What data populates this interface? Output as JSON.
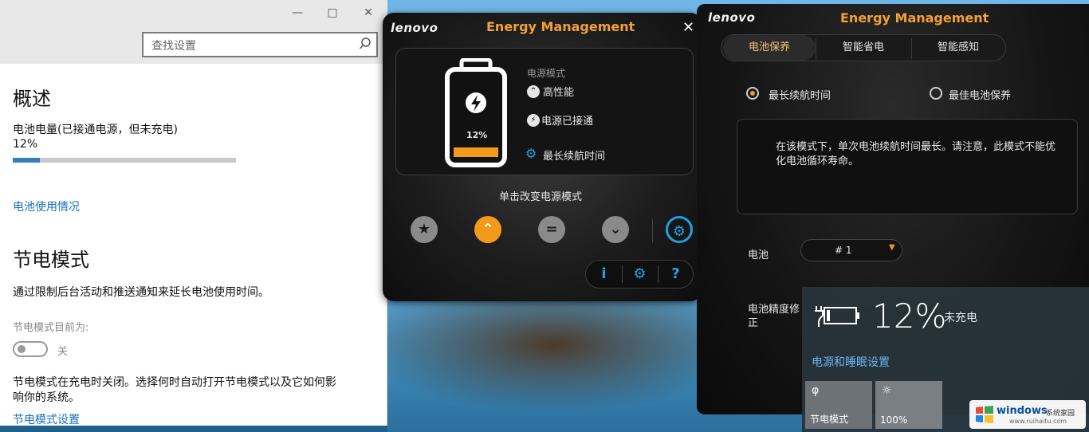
{
  "settings": {
    "search_placeholder": "查找设置",
    "heading_overview": "概述",
    "battery_level_label": "电池电量(已接通电源，但未充电)",
    "battery_percent": "12%",
    "battery_percent_value": 12,
    "battery_usage_link": "电池使用情况",
    "heading_saver": "节电模式",
    "saver_description": "通过限制后台活动和推送通知来延长电池使用时间。",
    "saver_status_label": "节电模式目前为:",
    "saver_toggle_label": "关",
    "saver_note_line1": "节电模式在充电时关闭。选择何时自动打开节电模式以及它如何影",
    "saver_note_line2": "响你的系统。",
    "saver_settings_link": "节电模式设置"
  },
  "em_compact": {
    "logo": "lenovo",
    "title": "Energy Management",
    "battery_percent": "12%",
    "power_mode_label": "电源模式",
    "power_mode_value": "高性能",
    "power_state": "电源已接通",
    "profile_name": "最长续航时间",
    "change_mode_hint": "单击改变电源模式",
    "accent_color": "#f39a1b",
    "link_color": "#1fa0e0"
  },
  "em_full": {
    "logo": "lenovo",
    "title": "Energy Management",
    "tabs": [
      {
        "label": "电池保养"
      },
      {
        "label": "智能省电"
      },
      {
        "label": "智能感知"
      }
    ],
    "option_longest": "最长续航时间",
    "option_best_care": "最佳电池保养",
    "description": "在该模式下，单次电池续航时间最长。请注意，此模式不能优化电池循环寿命。",
    "battery_label": "电池",
    "battery_select_value": "#   1",
    "calibration_label_line1": "电池精度修",
    "calibration_label_line2": "正"
  },
  "flyout": {
    "percent": "12%",
    "state": "未充电",
    "power_sleep_link": "电源和睡眠设置",
    "tile_saver_label": "节电模式",
    "tile_brightness_label": "100%"
  },
  "watermark": {
    "brand": "windows",
    "cn": "系统家园",
    "url": "www.ruihaitu.com"
  }
}
